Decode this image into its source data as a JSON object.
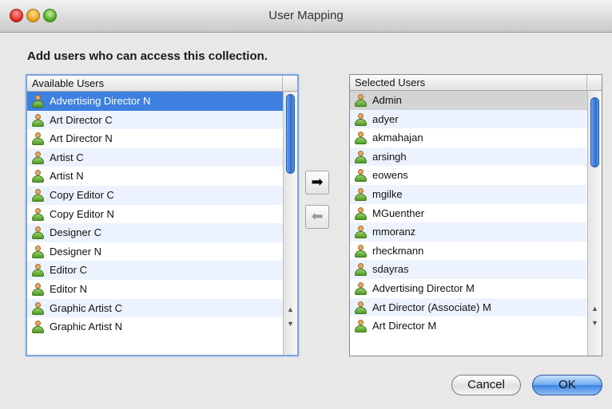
{
  "window": {
    "title": "User Mapping"
  },
  "heading": "Add users who can access this collection.",
  "available": {
    "header": "Available Users",
    "items": [
      "Advertising Director N",
      "Art Director C",
      "Art Director N",
      "Artist C",
      "Artist N",
      "Copy Editor C",
      "Copy Editor N",
      "Designer C",
      "Designer N",
      "Editor C",
      "Editor N",
      "Graphic Artist C",
      "Graphic Artist N"
    ]
  },
  "selected": {
    "header": "Selected Users",
    "items": [
      "Admin",
      "adyer",
      "akmahajan",
      "arsingh",
      "eowens",
      "mgilke",
      "MGuenther",
      "mmoranz",
      "rheckmann",
      "sdayras",
      "Advertising Director M",
      "Art Director (Associate) M",
      "Art Director M"
    ]
  },
  "buttons": {
    "add": "➡",
    "remove": "⬅",
    "cancel": "Cancel",
    "ok": "OK"
  },
  "scroll_arrows": {
    "up": "▲",
    "down": "▼"
  },
  "colors": {
    "accent": "#3d80df",
    "selected_gray": "#d4d4d4"
  },
  "icons": {
    "user": "user-icon"
  }
}
